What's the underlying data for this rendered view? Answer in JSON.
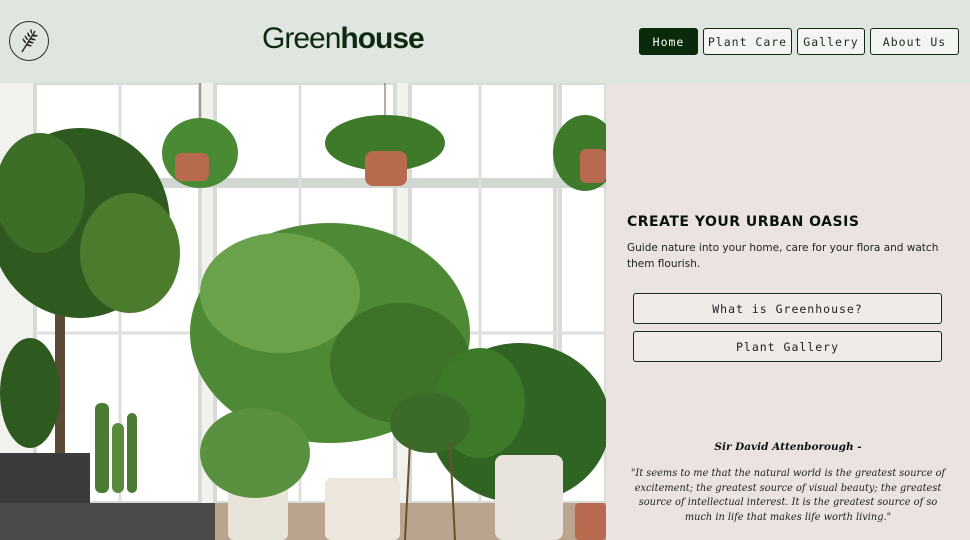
{
  "header": {
    "logo_icon": "fern-leaf-icon",
    "brand_light": "Green",
    "brand_bold": "house",
    "nav": [
      {
        "label": "Home",
        "active": true
      },
      {
        "label": "Plant Care",
        "active": false
      },
      {
        "label": "Gallery",
        "active": false
      },
      {
        "label": "About Us",
        "active": false
      }
    ]
  },
  "hero": {
    "image": "indoor-plants-photo"
  },
  "panel": {
    "headline": "CREATE YOUR URBAN OASIS",
    "subline": "Guide nature into your home, care for your flora and watch them flourish.",
    "buttons": [
      {
        "label": "What is Greenhouse?"
      },
      {
        "label": "Plant Gallery"
      }
    ],
    "quote_author": "Sir David Attenborough -",
    "quote_text": "\"It seems to me that the natural world is the greatest source of excitement; the greatest source of visual beauty; the greatest source of intellectual interest. It is the greatest source of so much in life that makes life worth living.\""
  },
  "colors": {
    "header_bg": "#dfe5df",
    "panel_bg": "#ebe3df",
    "accent_dark_green": "#0a2a0b"
  }
}
